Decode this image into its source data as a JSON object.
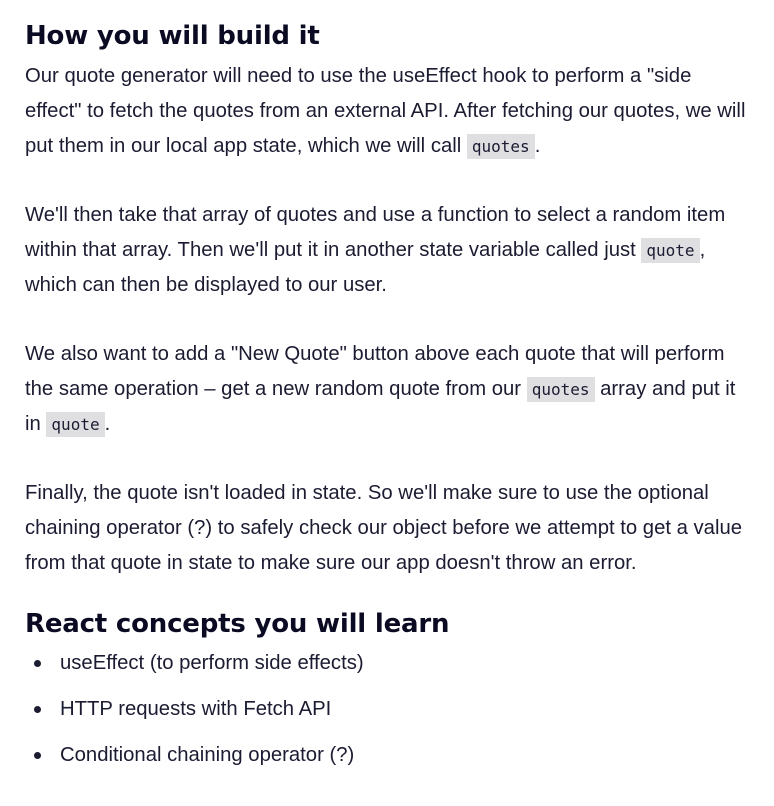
{
  "section1": {
    "heading": "How you will build it",
    "p1": {
      "text_a": "Our quote generator will need to use the useEffect hook to perform a \"side effect\" to fetch the quotes from an external API. After fetching our quotes, we will put them in our local app state, which we will call ",
      "code_a": "quotes",
      "text_b": "."
    },
    "p2": {
      "text_a": "We'll then take that array of quotes and use a function to select a random item within that array. Then we'll put it in another state variable called just ",
      "code_a": "quote",
      "text_b": ", which can then be displayed to our user."
    },
    "p3": {
      "text_a": "We also want to add a \"New Quote\" button above each quote that will perform the same operation – get a new random quote from our ",
      "code_a": "quotes",
      "text_b": " array and put it in ",
      "code_b": "quote",
      "text_c": "."
    },
    "p4": {
      "text": "Finally, the quote isn't loaded in state. So we'll make sure to use the optional chaining operator (?) to safely check our object before we attempt to get a value from that quote in state to make sure our app doesn't throw an error."
    }
  },
  "section2": {
    "heading": "React concepts you will learn",
    "items": [
      {
        "label": "useEffect (to perform side effects)"
      },
      {
        "label": "HTTP requests with Fetch API"
      },
      {
        "label": "Conditional chaining operator (?)"
      }
    ]
  }
}
